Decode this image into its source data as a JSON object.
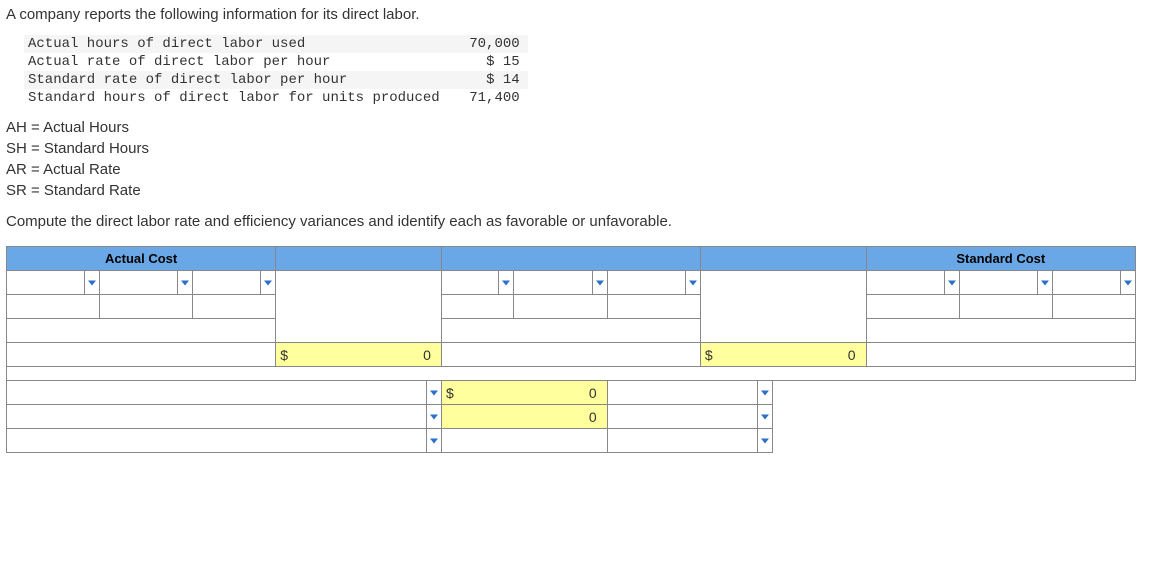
{
  "intro": "A company reports the following information for its direct labor.",
  "data_rows": [
    {
      "label": "Actual hours of direct labor used",
      "value": "70,000"
    },
    {
      "label": "Actual rate of direct labor per hour",
      "value": "$ 15"
    },
    {
      "label": "Standard rate of direct labor per hour",
      "value": "$ 14"
    },
    {
      "label": "Standard hours of direct labor for units produced",
      "value": "71,400"
    }
  ],
  "legend": [
    "AH = Actual Hours",
    "SH = Standard Hours",
    "AR = Actual Rate",
    "SR = Standard Rate"
  ],
  "instruction": "Compute the direct labor rate and efficiency variances and identify each as favorable or unfavorable.",
  "headers": {
    "actual": "Actual Cost",
    "standard": "Standard Cost"
  },
  "calc": {
    "dollar": "$",
    "zero": "0"
  }
}
